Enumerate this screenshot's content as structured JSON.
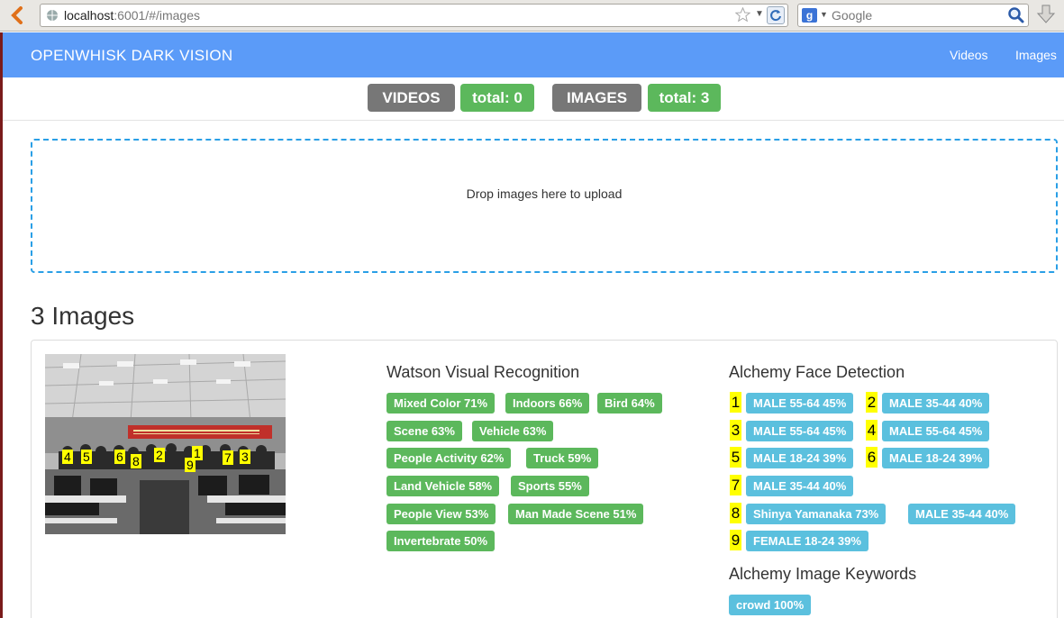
{
  "browser": {
    "url_host": "localhost",
    "url_rest": ":6001/#/images",
    "search_placeholder": "Google"
  },
  "navbar": {
    "brand": "OPENWHISK DARK VISION",
    "links": [
      "Videos",
      "Images"
    ]
  },
  "stats": {
    "videos_label": "VIDEOS",
    "videos_total": "total: 0",
    "images_label": "IMAGES",
    "images_total": "total: 3"
  },
  "dropzone": {
    "text": "Drop images here to upload"
  },
  "images": {
    "count_title": "3 Images",
    "face_markers": [
      "4",
      "5",
      "6",
      "8",
      "2",
      "1",
      "9",
      "7",
      "3"
    ],
    "banner_color": "#c0302a"
  },
  "watson": {
    "title": "Watson Visual Recognition",
    "tags": [
      "Mixed Color 71%",
      "Indoors 66%",
      "Bird 64%",
      "Scene 63%",
      "Vehicle 63%",
      "People Activity 62%",
      "Truck 59%",
      "Land Vehicle 58%",
      "Sports 55%",
      "People View 53%",
      "Man Made Scene 51%",
      "Invertebrate 50%"
    ]
  },
  "faces": {
    "title": "Alchemy Face Detection",
    "items": [
      {
        "num": "1",
        "label": "MALE 55-64 45%"
      },
      {
        "num": "2",
        "label": "MALE 35-44 40%"
      },
      {
        "num": "3",
        "label": "MALE 55-64 45%"
      },
      {
        "num": "4",
        "label": "MALE 55-64 45%"
      },
      {
        "num": "5",
        "label": "MALE 18-24 39%"
      },
      {
        "num": "6",
        "label": "MALE 18-24 39%"
      },
      {
        "num": "7",
        "label": "MALE 35-44 40%"
      },
      {
        "num": "8",
        "label": "Shinya Yamanaka 73%",
        "extra": "MALE 35-44 40%"
      },
      {
        "num": "9",
        "label": "FEMALE 18-24 39%"
      }
    ]
  },
  "keywords": {
    "title": "Alchemy Image Keywords",
    "tags": [
      "crowd 100%"
    ]
  },
  "colors": {
    "nav_bg": "#5b9bf8",
    "green": "#5cb85c",
    "cyan": "#5bc0de",
    "grey": "#777777",
    "highlight": "#ffff00",
    "dropzone_border": "#2a9fe6"
  }
}
